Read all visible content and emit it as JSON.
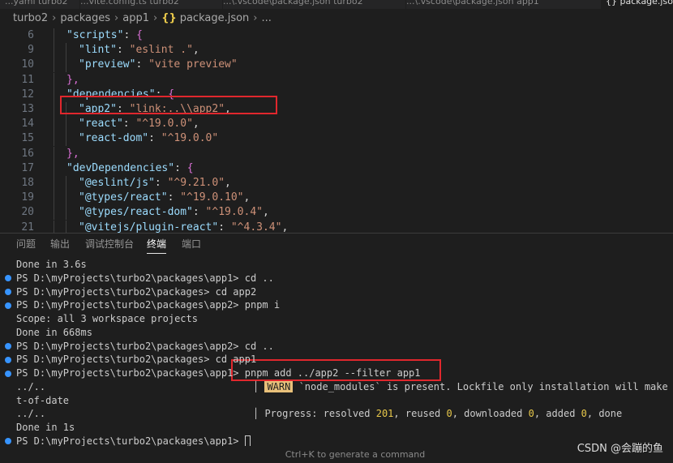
{
  "tabs": [
    {
      "label": "...yaml turbo2"
    },
    {
      "label": "...vite.config.ts turbo2"
    },
    {
      "label": "...\\.vscode\\package.json turbo2"
    },
    {
      "label": "...\\.vscode\\package.json app1"
    },
    {
      "label": "{} package.json"
    }
  ],
  "breadcrumb": {
    "parts": [
      "turbo2",
      "packages",
      "app1"
    ],
    "file": "package.json",
    "more": "..."
  },
  "editor": {
    "lines": [
      {
        "n": "6",
        "indent": 1,
        "key": "\"scripts\"",
        "after": ": ",
        "open": "{",
        "value": "",
        "tail": ""
      },
      {
        "n": "9",
        "indent": 2,
        "key": "\"lint\"",
        "after": ": ",
        "open": "",
        "value": "\"eslint .\"",
        "tail": ","
      },
      {
        "n": "10",
        "indent": 2,
        "key": "\"preview\"",
        "after": ": ",
        "open": "",
        "value": "\"vite preview\"",
        "tail": ""
      },
      {
        "n": "11",
        "indent": 1,
        "key": "",
        "after": "",
        "open": "},",
        "value": "",
        "tail": ""
      },
      {
        "n": "12",
        "indent": 1,
        "key": "\"dependencies\"",
        "after": ": ",
        "open": "{",
        "value": "",
        "tail": ""
      },
      {
        "n": "13",
        "indent": 2,
        "key": "\"app2\"",
        "after": ": ",
        "open": "",
        "value": "\"link:..\\\\app2\"",
        "tail": ","
      },
      {
        "n": "14",
        "indent": 2,
        "key": "\"react\"",
        "after": ": ",
        "open": "",
        "value": "\"^19.0.0\"",
        "tail": ","
      },
      {
        "n": "15",
        "indent": 2,
        "key": "\"react-dom\"",
        "after": ": ",
        "open": "",
        "value": "\"^19.0.0\"",
        "tail": ""
      },
      {
        "n": "16",
        "indent": 1,
        "key": "",
        "after": "",
        "open": "},",
        "value": "",
        "tail": ""
      },
      {
        "n": "17",
        "indent": 1,
        "key": "\"devDependencies\"",
        "after": ": ",
        "open": "{",
        "value": "",
        "tail": ""
      },
      {
        "n": "18",
        "indent": 2,
        "key": "\"@eslint/js\"",
        "after": ": ",
        "open": "",
        "value": "\"^9.21.0\"",
        "tail": ","
      },
      {
        "n": "19",
        "indent": 2,
        "key": "\"@types/react\"",
        "after": ": ",
        "open": "",
        "value": "\"^19.0.10\"",
        "tail": ","
      },
      {
        "n": "20",
        "indent": 2,
        "key": "\"@types/react-dom\"",
        "after": ": ",
        "open": "",
        "value": "\"^19.0.4\"",
        "tail": ","
      },
      {
        "n": "21",
        "indent": 2,
        "key": "\"@vitejs/plugin-react\"",
        "after": ": ",
        "open": "",
        "value": "\"^4.3.4\"",
        "tail": ","
      }
    ]
  },
  "panel": {
    "tabs": [
      {
        "label": "问题"
      },
      {
        "label": "输出"
      },
      {
        "label": "调试控制台"
      },
      {
        "label": "终端"
      },
      {
        "label": "端口"
      }
    ],
    "active": "终端"
  },
  "terminal": {
    "lines": [
      {
        "dot": false,
        "text": "Done in 3.6s"
      },
      {
        "dot": true,
        "text": "PS D:\\myProjects\\turbo2\\packages\\app1> cd .."
      },
      {
        "dot": true,
        "text": "PS D:\\myProjects\\turbo2\\packages> cd app2"
      },
      {
        "dot": true,
        "text": "PS D:\\myProjects\\turbo2\\packages\\app2> pnpm i"
      },
      {
        "dot": false,
        "text": "Scope: all 3 workspace projects"
      },
      {
        "dot": false,
        "text": "Done in 668ms"
      },
      {
        "dot": true,
        "text": "PS D:\\myProjects\\turbo2\\packages\\app2> cd .."
      },
      {
        "dot": true,
        "text": "PS D:\\myProjects\\turbo2\\packages> cd app1"
      },
      {
        "dot": true,
        "text": "PS D:\\myProjects\\turbo2\\packages\\app1> pnpm add ../app2 --filter app1"
      },
      {
        "dot": false,
        "text": "../..                                   "
      },
      {
        "dot": false,
        "text": "t-of-date"
      },
      {
        "dot": false,
        "text": "../..                                   "
      },
      {
        "dot": false,
        "text": "Done in 1s"
      },
      {
        "dot": true,
        "text": "PS D:\\myProjects\\turbo2\\packages\\app1> "
      }
    ],
    "warn_badge": "WARN",
    "warn_text": " `node_modules` is present. Lockfile only installation will make i",
    "progress": {
      "label": "Progress: resolved ",
      "resolved": "201",
      "reused_label": ", reused ",
      "reused": "0",
      "downloaded_label": ", downloaded ",
      "downloaded": "0",
      "added_label": ", added ",
      "added": "0",
      "done_label": ", done"
    }
  },
  "status_hint": "Ctrl+K to generate a command",
  "watermark": "CSDN @会蹦的鱼",
  "colors": {
    "highlight_box": "#e0272d",
    "json_key": "#9cdcfe",
    "json_string": "#ce9178",
    "terminal_dot": "#3794ff",
    "warn_badge": "#e8c07a"
  }
}
